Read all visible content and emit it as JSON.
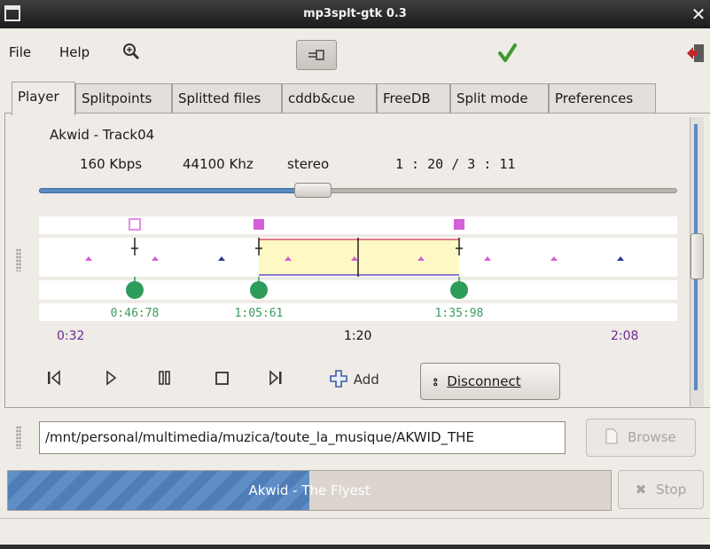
{
  "window": {
    "title": "mp3splt-gtk 0.3",
    "close_glyph": "✕"
  },
  "menu": {
    "file": "File",
    "help": "Help"
  },
  "tabs": [
    {
      "label": "Player"
    },
    {
      "label": "Splitpoints"
    },
    {
      "label": "Splitted files"
    },
    {
      "label": "cddb&cue"
    },
    {
      "label": "FreeDB"
    },
    {
      "label": "Split mode"
    },
    {
      "label": "Preferences"
    }
  ],
  "player": {
    "song_title": "Akwid - Track04",
    "bitrate": "160 Kbps",
    "frequency": "44100 Khz",
    "mode": "stereo",
    "time": "1 : 20 / 3 : 11",
    "seek_fraction": 0.42
  },
  "waveform": {
    "splitpoints": [
      {
        "label": "0:46:78",
        "color": "#e38ce6",
        "hollow": true
      },
      {
        "label": "1:05:61",
        "color": "#d55fd6",
        "hollow": false
      },
      {
        "label": "1:35:98",
        "color": "#d55fd6",
        "hollow": false
      }
    ],
    "time_labels": {
      "start": "0:32",
      "middle": "1:20",
      "end": "2:08"
    },
    "colors": {
      "splitpoint_dot": "#2e9c5a",
      "selection": "#fdf8c4",
      "label_green": "#3a9a5e",
      "label_purple": "#6d2a8f"
    }
  },
  "controls": {
    "add_label": "Add",
    "disconnect_label": "Disconnect"
  },
  "file": {
    "path": "/mnt/personal/multimedia/muzica/toute_la_musique/AKWID_THE",
    "browse_label": "Browse"
  },
  "progress": {
    "text": "Akwid - The Flyest",
    "fraction": 0.5,
    "stop_label": "Stop"
  }
}
